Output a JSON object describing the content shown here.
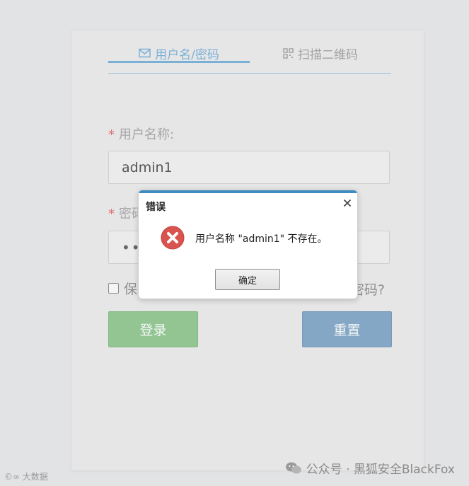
{
  "tabs": [
    {
      "label": "用户名/密码",
      "icon": "envelope-icon",
      "active": true
    },
    {
      "label": "扫描二维码",
      "icon": "qrcode-icon",
      "active": false
    }
  ],
  "form": {
    "username": {
      "required_mark": "*",
      "label": "用户名称:",
      "value": "admin1"
    },
    "password": {
      "required_mark": "*",
      "label": "密码",
      "value": "•••"
    },
    "remember_label": "保",
    "forgot_label": "密码?"
  },
  "buttons": {
    "login": "登录",
    "reset": "重置"
  },
  "dialog": {
    "title": "错误",
    "message": "用户名称 \"admin1\" 不存在。",
    "ok_label": "确定",
    "icon": "error-icon"
  },
  "watermarks": {
    "right": "公众号 · 黑狐安全BlackFox",
    "left": "©∞ 大数据"
  },
  "colors": {
    "tab_active": "#7ab0d6",
    "login_button": "#93c592",
    "reset_button": "#85a7c6",
    "required": "#e06d6d",
    "dialog_bar": "#3e8cbf",
    "error_red": "#d9534f"
  }
}
